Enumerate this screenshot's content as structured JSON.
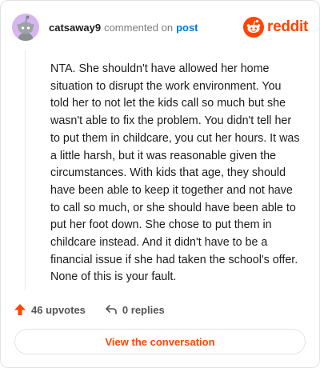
{
  "header": {
    "username": "catsaway9",
    "action_text": "commented on",
    "post_link": "post",
    "brand": "reddit"
  },
  "comment": {
    "text": "NTA. She shouldn't have allowed her home situation to disrupt the work environment. You told her to not let the kids call so much but she wasn't able to fix the problem. You didn't tell her to put them in childcare, you cut her hours. It was a little harsh, but it was reasonable given the circumstances. With kids that age, they should have been able to keep it together and not have to call so much, or she should have been able to put her foot down. She chose to put them in childcare instead. And it didn't have to be a financial issue if she had taken the school's offer. None of this is your fault."
  },
  "footer": {
    "upvotes_label": "46 upvotes",
    "replies_label": "0 replies",
    "cta_label": "View the conversation"
  },
  "icons": {
    "avatar": "snoo-avatar",
    "logo": "reddit-snoo-logo-icon",
    "upvote": "upvote-arrow-icon",
    "reply": "reply-arrow-icon"
  },
  "colors": {
    "brand": "#ff4500",
    "link": "#0079d3",
    "avatar_bg": "#d6b6ef"
  }
}
